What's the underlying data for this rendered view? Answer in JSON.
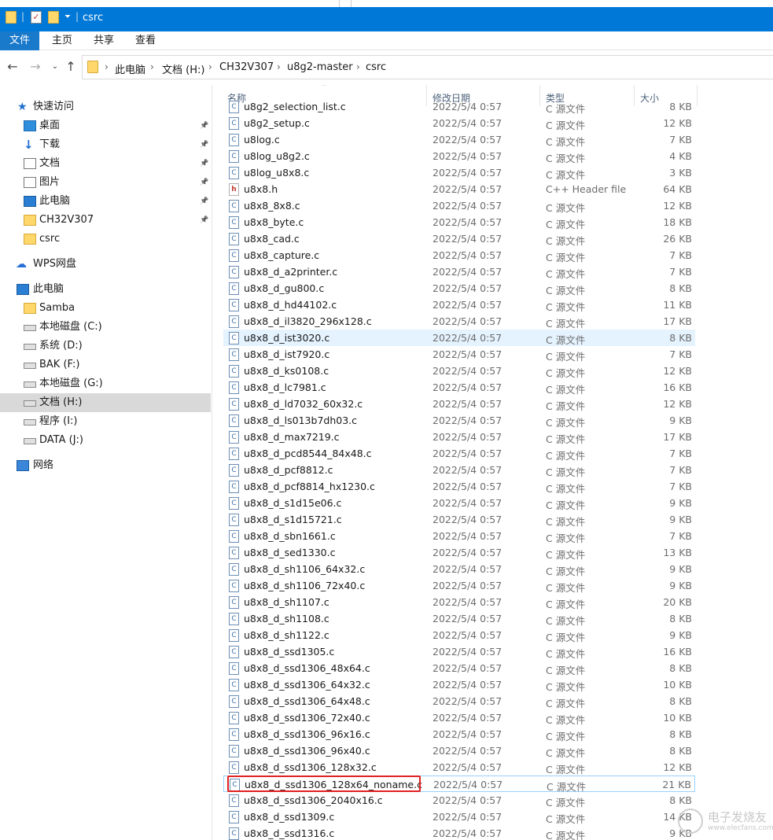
{
  "window": {
    "title": "csrc"
  },
  "ribbon": {
    "tabs": [
      "文件",
      "主页",
      "共享",
      "查看"
    ]
  },
  "address": {
    "crumbs": [
      "此电脑",
      "文档 (H:)",
      "CH32V307",
      "u8g2-master",
      "csrc"
    ]
  },
  "nav": {
    "quick_access": "快速访问",
    "items_quick": [
      {
        "label": "桌面",
        "icon": "desktop-icon",
        "pinned": true
      },
      {
        "label": "下载",
        "icon": "download-icon",
        "pinned": true
      },
      {
        "label": "文档",
        "icon": "document-icon",
        "pinned": true
      },
      {
        "label": "图片",
        "icon": "picture-icon",
        "pinned": true
      },
      {
        "label": "此电脑",
        "icon": "computer-icon",
        "pinned": true
      },
      {
        "label": "CH32V307",
        "icon": "folder-icon",
        "pinned": true
      },
      {
        "label": "csrc",
        "icon": "folder-icon",
        "pinned": false
      }
    ],
    "wps": "WPS网盘",
    "this_pc": "此电脑",
    "drives": [
      {
        "label": "Samba",
        "icon": "folder-icon"
      },
      {
        "label": "本地磁盘 (C:)",
        "icon": "drive-icon"
      },
      {
        "label": "系统 (D:)",
        "icon": "drive-icon"
      },
      {
        "label": "BAK (F:)",
        "icon": "drive-icon"
      },
      {
        "label": "本地磁盘 (G:)",
        "icon": "drive-icon"
      },
      {
        "label": "文档 (H:)",
        "icon": "drive-icon",
        "selected": true
      },
      {
        "label": "程序 (I:)",
        "icon": "drive-icon"
      },
      {
        "label": "DATA (J:)",
        "icon": "drive-icon"
      }
    ],
    "network": "网络"
  },
  "columns": {
    "name": "名称",
    "date": "修改日期",
    "type": "类型",
    "size": "大小"
  },
  "files": [
    {
      "name": "u8g2_selection_list.c",
      "date": "2022/5/4 0:57",
      "type": "C 源文件",
      "size": "8 KB",
      "kind": "c"
    },
    {
      "name": "u8g2_setup.c",
      "date": "2022/5/4 0:57",
      "type": "C 源文件",
      "size": "12 KB",
      "kind": "c"
    },
    {
      "name": "u8log.c",
      "date": "2022/5/4 0:57",
      "type": "C 源文件",
      "size": "7 KB",
      "kind": "c"
    },
    {
      "name": "u8log_u8g2.c",
      "date": "2022/5/4 0:57",
      "type": "C 源文件",
      "size": "4 KB",
      "kind": "c"
    },
    {
      "name": "u8log_u8x8.c",
      "date": "2022/5/4 0:57",
      "type": "C 源文件",
      "size": "3 KB",
      "kind": "c"
    },
    {
      "name": "u8x8.h",
      "date": "2022/5/4 0:57",
      "type": "C++ Header file",
      "size": "64 KB",
      "kind": "h"
    },
    {
      "name": "u8x8_8x8.c",
      "date": "2022/5/4 0:57",
      "type": "C 源文件",
      "size": "12 KB",
      "kind": "c"
    },
    {
      "name": "u8x8_byte.c",
      "date": "2022/5/4 0:57",
      "type": "C 源文件",
      "size": "18 KB",
      "kind": "c"
    },
    {
      "name": "u8x8_cad.c",
      "date": "2022/5/4 0:57",
      "type": "C 源文件",
      "size": "26 KB",
      "kind": "c"
    },
    {
      "name": "u8x8_capture.c",
      "date": "2022/5/4 0:57",
      "type": "C 源文件",
      "size": "7 KB",
      "kind": "c"
    },
    {
      "name": "u8x8_d_a2printer.c",
      "date": "2022/5/4 0:57",
      "type": "C 源文件",
      "size": "7 KB",
      "kind": "c"
    },
    {
      "name": "u8x8_d_gu800.c",
      "date": "2022/5/4 0:57",
      "type": "C 源文件",
      "size": "8 KB",
      "kind": "c"
    },
    {
      "name": "u8x8_d_hd44102.c",
      "date": "2022/5/4 0:57",
      "type": "C 源文件",
      "size": "11 KB",
      "kind": "c"
    },
    {
      "name": "u8x8_d_il3820_296x128.c",
      "date": "2022/5/4 0:57",
      "type": "C 源文件",
      "size": "17 KB",
      "kind": "c"
    },
    {
      "name": "u8x8_d_ist3020.c",
      "date": "2022/5/4 0:57",
      "type": "C 源文件",
      "size": "8 KB",
      "kind": "c",
      "hover": true
    },
    {
      "name": "u8x8_d_ist7920.c",
      "date": "2022/5/4 0:57",
      "type": "C 源文件",
      "size": "7 KB",
      "kind": "c"
    },
    {
      "name": "u8x8_d_ks0108.c",
      "date": "2022/5/4 0:57",
      "type": "C 源文件",
      "size": "12 KB",
      "kind": "c"
    },
    {
      "name": "u8x8_d_lc7981.c",
      "date": "2022/5/4 0:57",
      "type": "C 源文件",
      "size": "16 KB",
      "kind": "c"
    },
    {
      "name": "u8x8_d_ld7032_60x32.c",
      "date": "2022/5/4 0:57",
      "type": "C 源文件",
      "size": "12 KB",
      "kind": "c"
    },
    {
      "name": "u8x8_d_ls013b7dh03.c",
      "date": "2022/5/4 0:57",
      "type": "C 源文件",
      "size": "9 KB",
      "kind": "c"
    },
    {
      "name": "u8x8_d_max7219.c",
      "date": "2022/5/4 0:57",
      "type": "C 源文件",
      "size": "17 KB",
      "kind": "c"
    },
    {
      "name": "u8x8_d_pcd8544_84x48.c",
      "date": "2022/5/4 0:57",
      "type": "C 源文件",
      "size": "7 KB",
      "kind": "c"
    },
    {
      "name": "u8x8_d_pcf8812.c",
      "date": "2022/5/4 0:57",
      "type": "C 源文件",
      "size": "7 KB",
      "kind": "c"
    },
    {
      "name": "u8x8_d_pcf8814_hx1230.c",
      "date": "2022/5/4 0:57",
      "type": "C 源文件",
      "size": "7 KB",
      "kind": "c"
    },
    {
      "name": "u8x8_d_s1d15e06.c",
      "date": "2022/5/4 0:57",
      "type": "C 源文件",
      "size": "9 KB",
      "kind": "c"
    },
    {
      "name": "u8x8_d_s1d15721.c",
      "date": "2022/5/4 0:57",
      "type": "C 源文件",
      "size": "9 KB",
      "kind": "c"
    },
    {
      "name": "u8x8_d_sbn1661.c",
      "date": "2022/5/4 0:57",
      "type": "C 源文件",
      "size": "7 KB",
      "kind": "c"
    },
    {
      "name": "u8x8_d_sed1330.c",
      "date": "2022/5/4 0:57",
      "type": "C 源文件",
      "size": "13 KB",
      "kind": "c"
    },
    {
      "name": "u8x8_d_sh1106_64x32.c",
      "date": "2022/5/4 0:57",
      "type": "C 源文件",
      "size": "9 KB",
      "kind": "c"
    },
    {
      "name": "u8x8_d_sh1106_72x40.c",
      "date": "2022/5/4 0:57",
      "type": "C 源文件",
      "size": "9 KB",
      "kind": "c"
    },
    {
      "name": "u8x8_d_sh1107.c",
      "date": "2022/5/4 0:57",
      "type": "C 源文件",
      "size": "20 KB",
      "kind": "c"
    },
    {
      "name": "u8x8_d_sh1108.c",
      "date": "2022/5/4 0:57",
      "type": "C 源文件",
      "size": "8 KB",
      "kind": "c"
    },
    {
      "name": "u8x8_d_sh1122.c",
      "date": "2022/5/4 0:57",
      "type": "C 源文件",
      "size": "9 KB",
      "kind": "c"
    },
    {
      "name": "u8x8_d_ssd1305.c",
      "date": "2022/5/4 0:57",
      "type": "C 源文件",
      "size": "16 KB",
      "kind": "c"
    },
    {
      "name": "u8x8_d_ssd1306_48x64.c",
      "date": "2022/5/4 0:57",
      "type": "C 源文件",
      "size": "8 KB",
      "kind": "c"
    },
    {
      "name": "u8x8_d_ssd1306_64x32.c",
      "date": "2022/5/4 0:57",
      "type": "C 源文件",
      "size": "10 KB",
      "kind": "c"
    },
    {
      "name": "u8x8_d_ssd1306_64x48.c",
      "date": "2022/5/4 0:57",
      "type": "C 源文件",
      "size": "8 KB",
      "kind": "c"
    },
    {
      "name": "u8x8_d_ssd1306_72x40.c",
      "date": "2022/5/4 0:57",
      "type": "C 源文件",
      "size": "10 KB",
      "kind": "c"
    },
    {
      "name": "u8x8_d_ssd1306_96x16.c",
      "date": "2022/5/4 0:57",
      "type": "C 源文件",
      "size": "8 KB",
      "kind": "c"
    },
    {
      "name": "u8x8_d_ssd1306_96x40.c",
      "date": "2022/5/4 0:57",
      "type": "C 源文件",
      "size": "8 KB",
      "kind": "c"
    },
    {
      "name": "u8x8_d_ssd1306_128x32.c",
      "date": "2022/5/4 0:57",
      "type": "C 源文件",
      "size": "12 KB",
      "kind": "c"
    },
    {
      "name": "u8x8_d_ssd1306_128x64_noname.c",
      "date": "2022/5/4 0:57",
      "type": "C 源文件",
      "size": "21 KB",
      "kind": "c",
      "selected": true
    },
    {
      "name": "u8x8_d_ssd1306_2040x16.c",
      "date": "2022/5/4 0:57",
      "type": "C 源文件",
      "size": "8 KB",
      "kind": "c"
    },
    {
      "name": "u8x8_d_ssd1309.c",
      "date": "2022/5/4 0:57",
      "type": "C 源文件",
      "size": "14 KB",
      "kind": "c"
    },
    {
      "name": "u8x8_d_ssd1316.c",
      "date": "2022/5/4 0:57",
      "type": "C 源文件",
      "size": "9 KB",
      "kind": "c"
    }
  ],
  "watermark": {
    "line1": "电子发烧友",
    "line2": "www.elecfans.com"
  },
  "colors": {
    "titlebar": "#0078d7",
    "highlight_box": "#e02020",
    "selected_nav": "#d9d9d9"
  }
}
